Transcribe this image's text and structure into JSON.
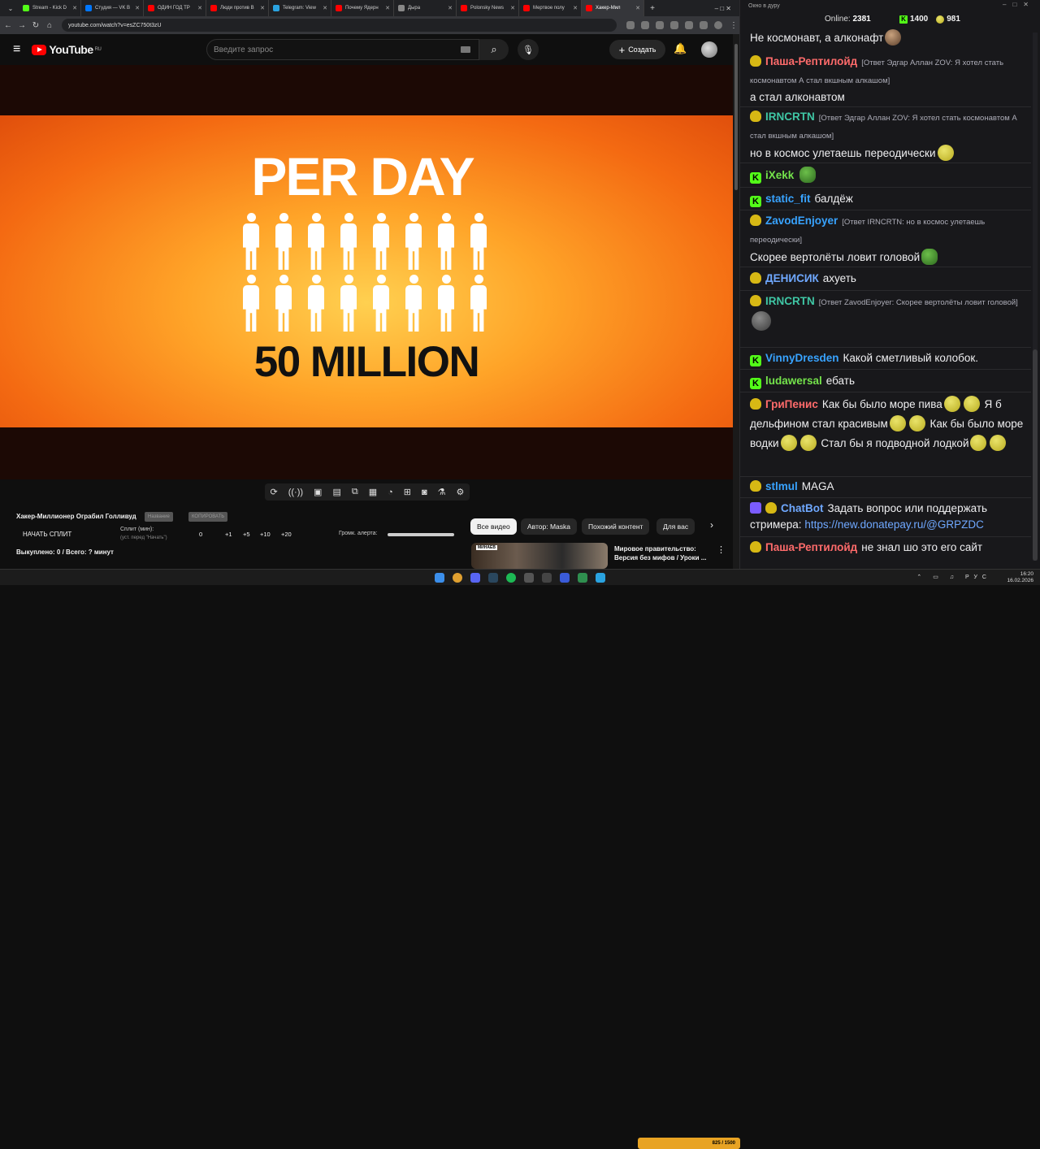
{
  "browser": {
    "tabs": [
      {
        "label": "Stream - Kick D",
        "color": "#53fc18"
      },
      {
        "label": "Студия — VK В",
        "color": "#0077ff"
      },
      {
        "label": "ОДИН ГОД ТР",
        "color": "#ff0000"
      },
      {
        "label": "Люди против В",
        "color": "#ff0000"
      },
      {
        "label": "Telegram: View",
        "color": "#2aa3e0"
      },
      {
        "label": "Почему Ядерн",
        "color": "#ff0000"
      },
      {
        "label": "Дыра",
        "color": "#888888"
      },
      {
        "label": "Polonsky News",
        "color": "#ff0000"
      },
      {
        "label": "Мертвое полу",
        "color": "#ff0000"
      },
      {
        "label": "Хакер-Мил",
        "color": "#ff0000"
      }
    ],
    "url": "youtube.com/watch?v=esZC750t3zU"
  },
  "youtube": {
    "logo": "YouTube",
    "region": "RU",
    "search_placeholder": "Введите запрос",
    "create_label": "Создать"
  },
  "video": {
    "line1": "PER DAY",
    "line2": "50 MILLION",
    "figures_per_row": 8,
    "rows": 2
  },
  "extension": {
    "title": "Хакер-Миллионер Ограбил Голливуд",
    "pill1": "Название",
    "pill2": "КОПИРОВАТЬ",
    "start_split": "НАЧАТЬ СПЛИТ",
    "split_label": "Сплит (мин):",
    "split_hint": "(уст. перед \"Начать\")",
    "nums": [
      "0",
      "+1",
      "+5",
      "+10",
      "+20"
    ],
    "volume_label": "Громк. алерта:",
    "bought": "Выкуплено: 0 / Всего: ? минут"
  },
  "chips": [
    "Все видео",
    "Автор: Maska",
    "Похожий контент",
    "Для вас"
  ],
  "recommendation": {
    "tag": "МИНАЕВ",
    "title": "Мировое правительство: Версия без мифов / Уроки ..."
  },
  "chat": {
    "window_title": "Окно в дуру",
    "online_label": "Online:",
    "online_count": "2381",
    "kick_count": "1400",
    "other_count": "981",
    "messages": [
      {
        "user": "",
        "text": "Не космонавт, а алконафт",
        "reply": ""
      },
      {
        "user": "Паша-Рептилойд",
        "color": "#ff6b6b",
        "reply": "[Ответ Эдгар Аллан ZOV: Я хотел стать космонавтом А стал вкшным алкашом]",
        "text": "а стал алконавтом"
      },
      {
        "user": "IRNCRTN",
        "color": "#3fc7a5",
        "reply": "[Ответ Эдгар Аллан ZOV: Я хотел стать космонавтом А стал вкшным алкашом]",
        "text": "но в космос улетаешь переодически"
      },
      {
        "user": "iXekk",
        "color": "#74e34b",
        "reply": "",
        "text": ""
      },
      {
        "user": "static_fit",
        "color": "#38a3ff",
        "reply": "",
        "text": "балдёж"
      },
      {
        "user": "ZavodEnjoyer",
        "color": "#38a3ff",
        "reply": "[Ответ IRNCRTN: но в космос улетаешь переодически]",
        "text": "Скорее вертолёты ловит головой"
      },
      {
        "user": "ДЕНИСИК",
        "color": "#6fa8ff",
        "reply": "",
        "text": "ахуеть"
      },
      {
        "user": "IRNCRTN",
        "color": "#3fc7a5",
        "reply": "[Ответ ZavodEnjoyer: Скорее вертолёты ловит головой]",
        "text": ""
      },
      {
        "user": "VinnyDresden",
        "color": "#38a3ff",
        "reply": "",
        "text": "Какой сметливый колобок."
      },
      {
        "user": "ludawersal",
        "color": "#74e34b",
        "reply": "",
        "text": "ебать"
      },
      {
        "user": "ГриПенис",
        "color": "#ff6b6b",
        "reply": "",
        "text1": "Как бы было море пива",
        "text2": "Я б дельфином стал красивым",
        "text3": "Как бы было море водки",
        "text4": "Стал бы я подводной лодкой"
      },
      {
        "user": "stlmul",
        "color": "#38a3ff",
        "reply": "",
        "text": "MAGA"
      },
      {
        "user": "ChatBot",
        "color": "#6fa8ff",
        "reply": "",
        "text": "Задать вопрос или поддержать стримера:",
        "link": "https://new.donatepay.ru/@GRPZDC"
      },
      {
        "user": "Паша-Рептилойд",
        "color": "#ff6b6b",
        "reply": "",
        "text": "не знал шо это его сайт"
      }
    ]
  },
  "taskbar": {
    "lang": "РУС",
    "time": "16:20",
    "date": "16.02.2026",
    "donate_text": "825 / 1500"
  }
}
